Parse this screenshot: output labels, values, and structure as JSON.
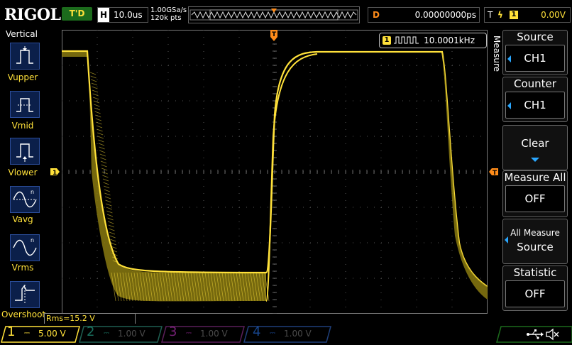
{
  "brand": "RIGOL",
  "top": {
    "trigger_status": "T'D",
    "horiz_label": "H",
    "timebase": "10.0us",
    "sample_rate": "1.00GSa/s",
    "mem_depth": "120k pts",
    "delay_label": "D",
    "delay_value": "0.00000000ps",
    "trig_label": "T",
    "trig_edge": "ϟ",
    "trig_channel": "1",
    "trig_level": "0.00V"
  },
  "left_panel": {
    "title": "Vertical",
    "items": [
      {
        "label": "Vupper",
        "icon": "vupper-icon"
      },
      {
        "label": "Vmid",
        "icon": "vmid-icon"
      },
      {
        "label": "Vlower",
        "icon": "vlower-icon"
      },
      {
        "label": "Vavg",
        "icon": "vavg-icon"
      },
      {
        "label": "Vrms",
        "icon": "vrms-icon"
      },
      {
        "label": "Overshoot",
        "icon": "overshoot-icon"
      }
    ]
  },
  "screen": {
    "ch1_marker": "1",
    "trig_marker": "T",
    "freq_channel": "1",
    "frequency": "10.0001kHz",
    "rms": "Rms=15.2 V"
  },
  "right_menu": {
    "title": "Measure",
    "source_label": "Source",
    "source_value": "CH1",
    "counter_label": "Counter",
    "counter_value": "CH1",
    "clear_label": "Clear",
    "measure_all_label": "Measure All",
    "measure_all_value": "OFF",
    "all_measure_label": "All Measure",
    "all_measure_value": "Source",
    "statistic_label": "Statistic",
    "statistic_value": "OFF"
  },
  "channels": [
    {
      "num": "1",
      "scale": "5.00 V",
      "color": "#ffe13a"
    },
    {
      "num": "2",
      "scale": "1.00 V",
      "color": "#2fc7a8"
    },
    {
      "num": "3",
      "scale": "1.00 V",
      "color": "#d23bd2"
    },
    {
      "num": "4",
      "scale": "1.00 V",
      "color": "#2a7fff"
    }
  ],
  "colors": {
    "ch1": "#ffe13a",
    "trigger": "#ff8c1a",
    "accent": "#2aa7ff"
  }
}
